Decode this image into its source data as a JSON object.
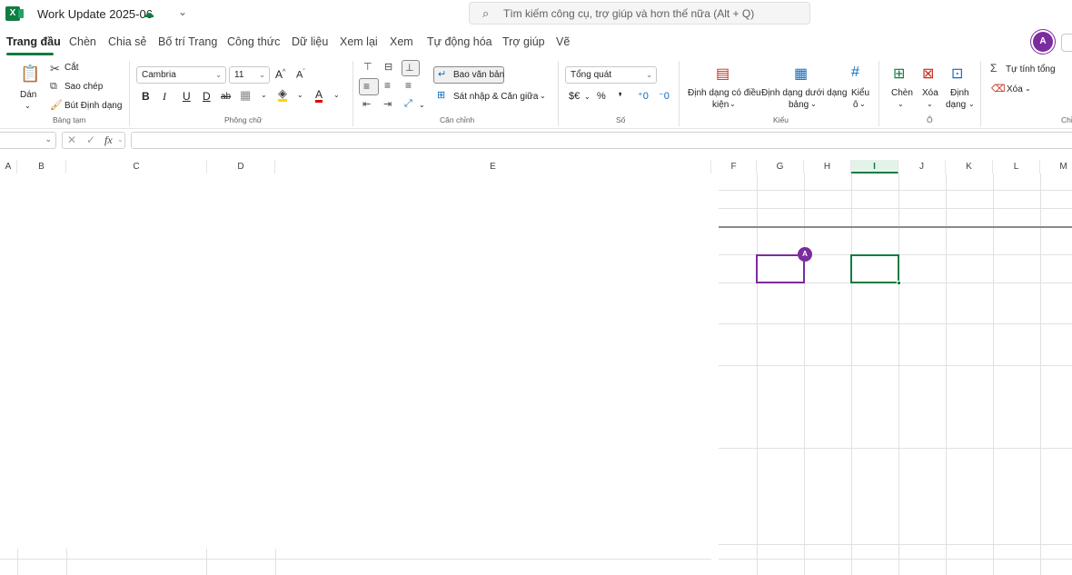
{
  "app": {
    "logo_letter": "X",
    "title": "Work Update 2025-06",
    "search_placeholder": "Tìm kiếm công cụ, trợ giúp và hơn thế nữa (Alt + Q)"
  },
  "tabs": [
    {
      "label": "Trang đầu",
      "active": true
    },
    {
      "label": "Chèn"
    },
    {
      "label": "Chia sẻ"
    },
    {
      "label": "Bố trí Trang"
    },
    {
      "label": "Công thức"
    },
    {
      "label": "Dữ liệu"
    },
    {
      "label": "Xem lại"
    },
    {
      "label": "Xem"
    },
    {
      "label": "Tự động hóa"
    },
    {
      "label": "Trợ giúp"
    },
    {
      "label": "Vẽ"
    }
  ],
  "user": {
    "avatar_initial": "A"
  },
  "ribbon": {
    "clipboard": {
      "paste": "Dán",
      "cut": "Cắt",
      "copy": "Sao chép",
      "format_painter": "Bút Định dạng",
      "group": "Bảng tạm"
    },
    "font": {
      "name": "Cambria",
      "size": "11",
      "bold": "B",
      "italic": "I",
      "underline": "U",
      "double_underline": "D",
      "strike": "ab",
      "group": "Phông chữ"
    },
    "alignment": {
      "wrap_text": "Bao văn bản",
      "merge_center": "Sát nhập & Căn giữa",
      "group": "Căn chỉnh"
    },
    "number": {
      "format": "Tổng quát",
      "currency": "$€",
      "percent": "%",
      "comma": "❜",
      "group": "Số"
    },
    "styles": {
      "conditional_1": "Định dạng có điều",
      "conditional_2": "kiện",
      "table_1": "Định dạng dưới dạng",
      "table_2": "bảng",
      "cell_styles_1": "Kiểu",
      "cell_styles_2": "ô",
      "group": "Kiểu"
    },
    "cells": {
      "insert": "Chèn",
      "delete": "Xóa",
      "format_1": "Định",
      "format_2": "dạng",
      "group": "Ô"
    },
    "editing": {
      "autosum": "Tự tính tổng",
      "clear": "Xóa",
      "group": "Chỉ"
    }
  },
  "formula_bar": {
    "fx": "fx",
    "value": ""
  },
  "sheet": {
    "columns": [
      "A",
      "B",
      "C",
      "D",
      "E",
      "F",
      "G",
      "H",
      "I",
      "J",
      "K",
      "L",
      "M"
    ],
    "selected_column": "I",
    "collaborator_initial": "A"
  },
  "colors": {
    "accent": "#107c41",
    "collaborator": "#7b2c9e"
  }
}
